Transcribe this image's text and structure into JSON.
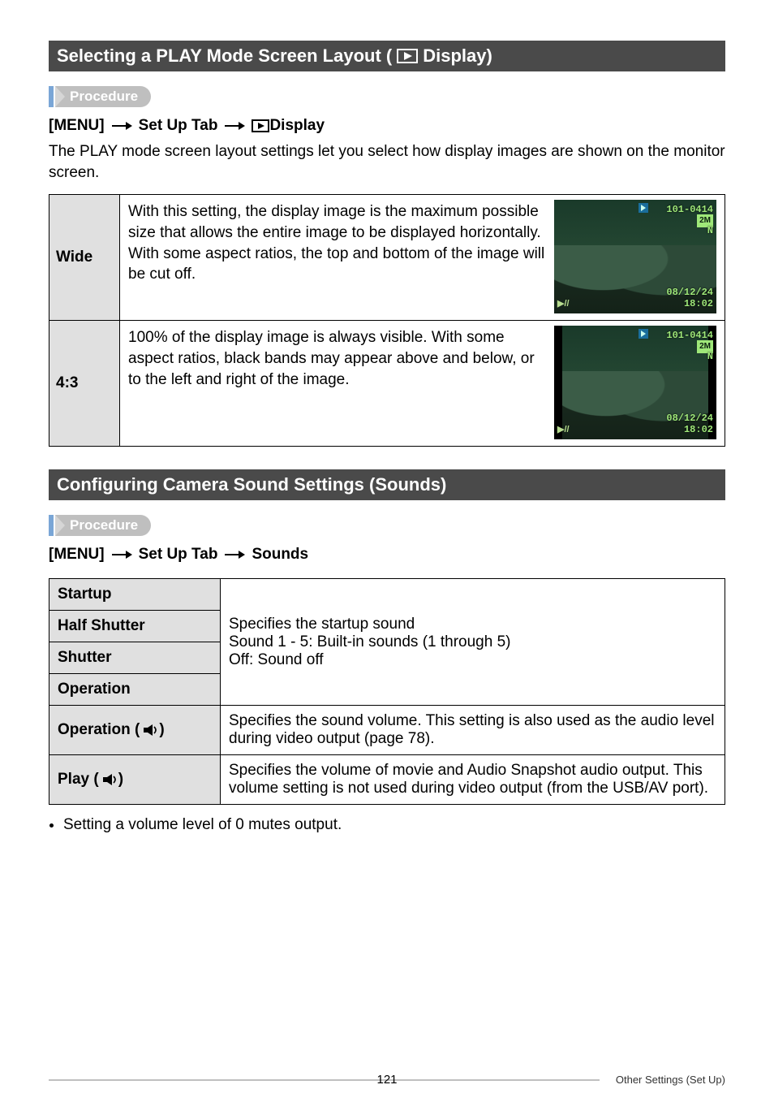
{
  "sections": {
    "s1_prefix": "Selecting a PLAY Mode Screen Layout (",
    "s1_suffix": " Display)",
    "s2": "Configuring Camera Sound Settings (Sounds)"
  },
  "procedure_label": "Procedure",
  "menu_line1": {
    "a": "[MENU]",
    "b": "Set Up Tab",
    "c": " Display"
  },
  "paragraph1": "The PLAY mode screen layout settings let you select how display images are shown on the monitor screen.",
  "table1": {
    "rows": [
      {
        "label": "Wide",
        "desc": "With this setting, the display image is the maximum possible size that allows the entire image to be displayed horizontally. With some aspect ratios, the top and bottom of the image will be cut off."
      },
      {
        "label": "4:3",
        "desc": "100% of the display image is always visible. With some aspect ratios, black bands may appear above and below, or to the left and right of the image."
      }
    ]
  },
  "preview_text": {
    "id": "101-0414",
    "badge": "2M",
    "n": "N",
    "date": "08/12/24",
    "time": "18:02",
    "bl": "▶//"
  },
  "menu_line2": {
    "a": "[MENU]",
    "b": "Set Up Tab",
    "c": "Sounds"
  },
  "sound_table": {
    "startup": "Startup",
    "half": "Half Shutter",
    "shutter": "Shutter",
    "operation": "Operation",
    "op_vol": "Operation (",
    "play_vol": "Play (",
    "close": ")",
    "desc1a": "Specifies the startup sound",
    "desc1b": "Sound 1 - 5: Built-in sounds (1 through 5)",
    "desc1c": "Off: Sound off",
    "desc2": "Specifies the sound volume. This setting is also used as the audio level during video output (page 78).",
    "desc3": "Specifies the volume of movie and Audio Snapshot audio output. This volume setting is not used during video output (from the USB/AV port)."
  },
  "bullet": "Setting a volume level of 0 mutes output.",
  "footer": {
    "page": "121",
    "trail": "Other Settings (Set Up)"
  }
}
